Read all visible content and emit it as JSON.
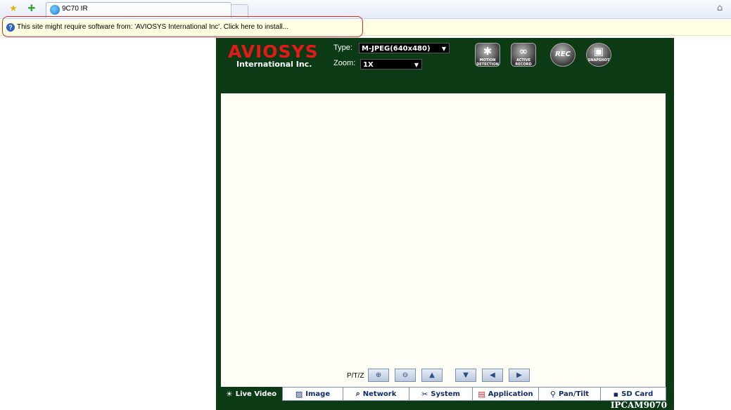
{
  "browser": {
    "tab_title": "9C70 IR",
    "toolbar_icons": [
      "favorites-star-icon",
      "add-favorites-icon"
    ],
    "home_icon": "home-icon"
  },
  "infobar": {
    "message": "This site might require software from: 'AVIOSYS International Inc'. Click here to install...",
    "icon": "info-icon"
  },
  "camera": {
    "logo_main": "AVIOSYS",
    "logo_sub": "International Inc.",
    "type_label": "Type:",
    "type_value": "M-JPEG(640x480)",
    "zoom_label": "Zoom:",
    "zoom_value": "1X",
    "controls": [
      {
        "name": "motion-detection-button",
        "label": "MOTION\nDETECTION"
      },
      {
        "name": "active-record-button",
        "label": "ACTIVE\nRECORD"
      },
      {
        "name": "rec-button",
        "label": "REC"
      },
      {
        "name": "snapshot-button",
        "label": "SNAPSHOT"
      }
    ],
    "ptz_label": "P/T/Z",
    "ptz_buttons": [
      "zoom-in-icon",
      "zoom-out-icon",
      "up-arrow-icon",
      "down-arrow-icon",
      "left-arrow-icon",
      "right-arrow-icon"
    ],
    "nav": [
      {
        "label": "Live Video",
        "active": true
      },
      {
        "label": "Image",
        "active": false
      },
      {
        "label": "Network",
        "active": false
      },
      {
        "label": "System",
        "active": false
      },
      {
        "label": "Application",
        "active": false
      },
      {
        "label": "Pan/Tilt",
        "active": false
      },
      {
        "label": "SD Card",
        "active": false
      }
    ],
    "model": "IPCAM9070"
  },
  "colors": {
    "frame_green": "#0b3a14",
    "logo_red": "#e21a1a",
    "infobar_yellow": "#ffffe1",
    "highlight_outline": "#d32c2c"
  }
}
